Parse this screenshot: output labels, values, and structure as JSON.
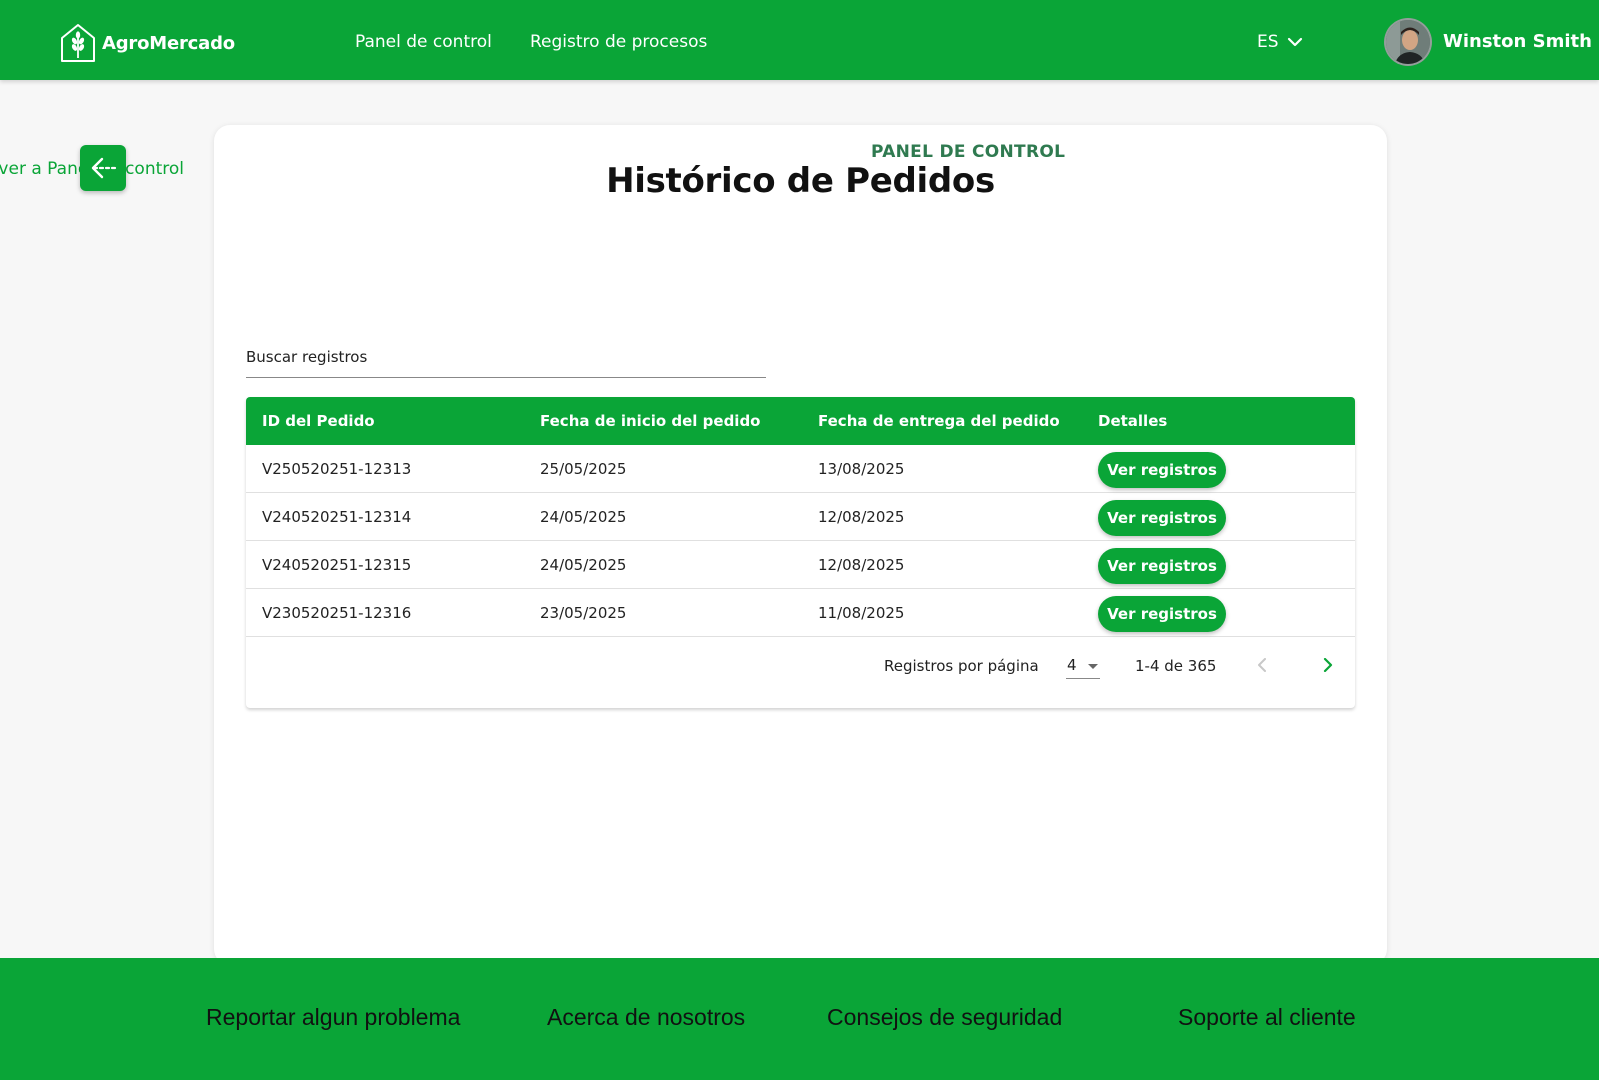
{
  "header": {
    "brand": "AgroMercado",
    "nav": [
      "Panel de control",
      "Registro de procesos"
    ],
    "language": "ES",
    "user_name": "Winston Smith"
  },
  "back_link_label": "Volver a Panel de control",
  "page": {
    "eyebrow": "PANEL DE CONTROL",
    "title": "Histórico de Pedidos"
  },
  "search": {
    "placeholder": "Buscar registros"
  },
  "table": {
    "columns": [
      "ID del Pedido",
      "Fecha de inicio del pedido",
      "Fecha de entrega del pedido",
      "Detalles"
    ],
    "rows": [
      {
        "id": "V250520251-12313",
        "start": "25/05/2025",
        "delivery": "13/08/2025",
        "action": "Ver registros"
      },
      {
        "id": "V240520251-12314",
        "start": "24/05/2025",
        "delivery": "12/08/2025",
        "action": "Ver registros"
      },
      {
        "id": "V240520251-12315",
        "start": "24/05/2025",
        "delivery": "12/08/2025",
        "action": "Ver registros"
      },
      {
        "id": "V230520251-12316",
        "start": "23/05/2025",
        "delivery": "11/08/2025",
        "action": "Ver registros"
      }
    ]
  },
  "pagination": {
    "rows_per_page_label": "Registros por página",
    "rows_per_page": "4",
    "range": "1-4 de 365"
  },
  "footer": {
    "links": [
      "Reportar algun problema",
      "Acerca de nosotros",
      "Consejos de seguridad",
      "Soporte al cliente"
    ]
  },
  "colors": {
    "brand_green": "#0aa537",
    "eyebrow_green": "#2f7a50",
    "background": "#f7f7f7"
  },
  "icons": {
    "logo": "wheat-house-icon",
    "language_dropdown": "chevron-down-icon",
    "back": "arrow-left-icon",
    "prev_page": "chevron-left-icon",
    "next_page": "chevron-right-icon"
  }
}
